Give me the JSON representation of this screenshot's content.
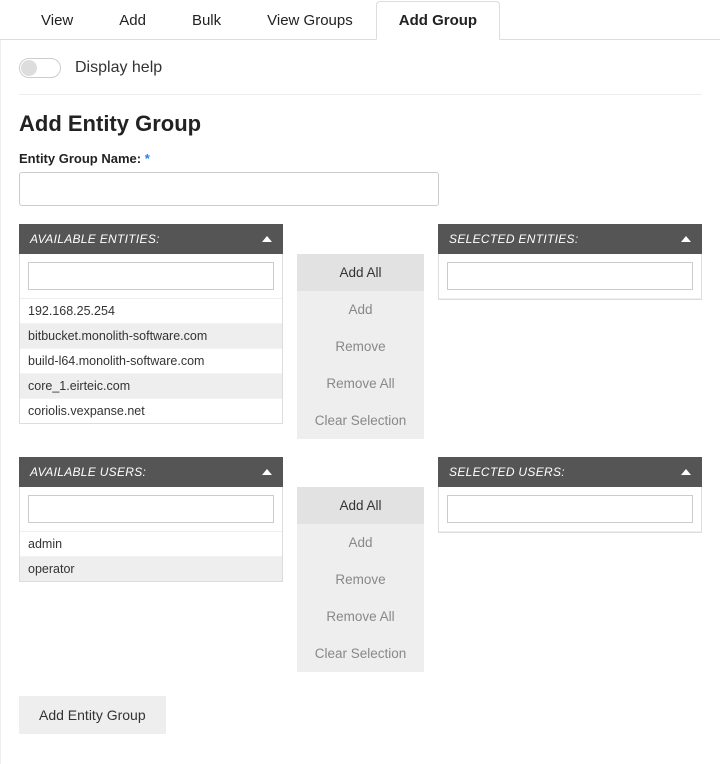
{
  "tabs": {
    "0": "View",
    "1": "Add",
    "2": "Bulk",
    "3": "View Groups",
    "4": "Add Group"
  },
  "help": {
    "label": "Display help"
  },
  "page": {
    "title": "Add Entity Group"
  },
  "form": {
    "group_name_label": "Entity Group Name:",
    "group_name_value": ""
  },
  "entities": {
    "available_header": "AVAILABLE ENTITIES:",
    "selected_header": "SELECTED ENTITIES:",
    "filter_value": "",
    "items": {
      "0": "192.168.25.254",
      "1": "bitbucket.monolith-software.com",
      "2": "build-l64.monolith-software.com",
      "3": "core_1.eirteic.com",
      "4": "coriolis.vexpanse.net"
    }
  },
  "users": {
    "available_header": "AVAILABLE USERS:",
    "selected_header": "SELECTED USERS:",
    "filter_value": "",
    "items": {
      "0": "admin",
      "1": "operator"
    }
  },
  "transfer": {
    "add_all": "Add All",
    "add": "Add",
    "remove": "Remove",
    "remove_all": "Remove All",
    "clear": "Clear Selection"
  },
  "submit": {
    "label": "Add Entity Group"
  }
}
